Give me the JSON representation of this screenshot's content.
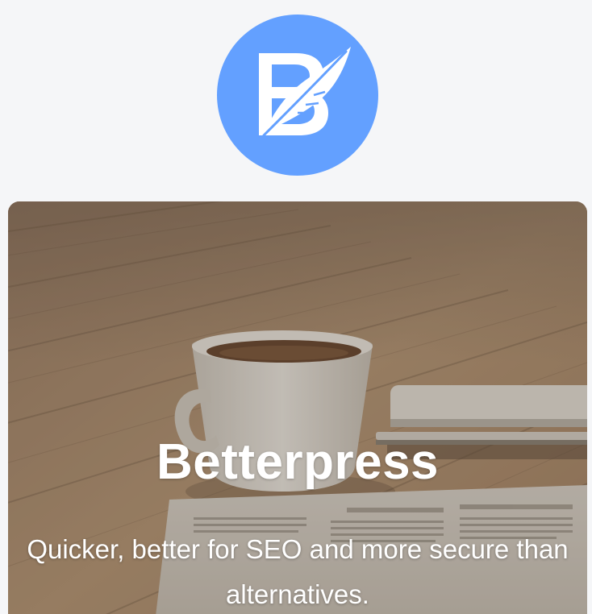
{
  "brand": {
    "logo_icon": "betterpress-feather-b-logo",
    "logo_color": "#63a0ff",
    "logo_letter": "B"
  },
  "hero": {
    "title": "Betterpress",
    "subtitle": "Quicker, better for SEO and more secure than alternatives.",
    "background_image": "coffee-cup-phone-newspaper-on-wooden-table",
    "text_color": "#ffffff"
  },
  "colors": {
    "page_background": "#f5f6f8",
    "accent": "#63a0ff"
  }
}
